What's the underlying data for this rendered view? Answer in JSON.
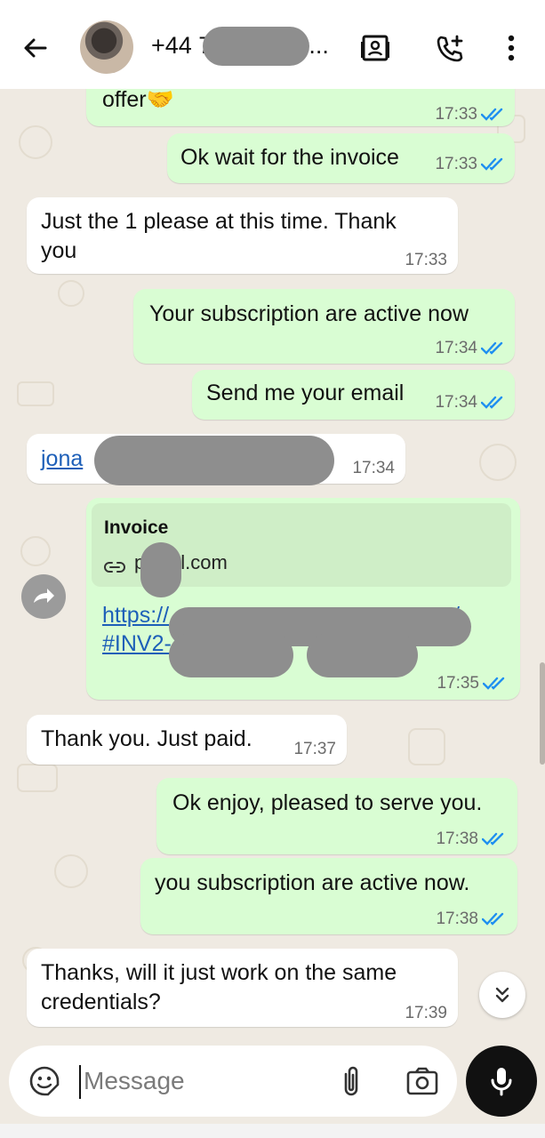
{
  "header": {
    "back_icon": "arrow-left-icon",
    "title": "+44 7",
    "title_suffix": "3...",
    "contact_icon": "contact-card-icon",
    "call_icon": "add-call-icon",
    "menu_icon": "more-vert-icon"
  },
  "messages": [
    {
      "dir": "out",
      "text": "offer🤝",
      "time": "17:33",
      "ticks": true
    },
    {
      "dir": "out",
      "text": "Ok wait for the invoice",
      "time": "17:33",
      "ticks": true
    },
    {
      "dir": "in",
      "line1": "Just the 1 please at this time. Thank",
      "line2": "you",
      "time": "17:33"
    },
    {
      "dir": "out",
      "text": "Your subscription are active now",
      "time": "17:34",
      "ticks": true
    },
    {
      "dir": "out",
      "text": "Send me your email",
      "time": "17:34",
      "ticks": true
    },
    {
      "dir": "in",
      "link": "jona",
      "time": "17:34"
    },
    {
      "dir": "out",
      "preview_title": "Invoice",
      "preview_domain_start": "p",
      "preview_domain_end": "l.com",
      "url_line1": "https://",
      "url_line1_end": "/",
      "url_line2": "#INV2-",
      "time": "17:35",
      "ticks": true
    },
    {
      "dir": "in",
      "text": "Thank you. Just paid.",
      "time": "17:37"
    },
    {
      "dir": "out",
      "text": "Ok enjoy, pleased to serve you.",
      "time": "17:38",
      "ticks": true
    },
    {
      "dir": "out",
      "text": "you subscription are active now.",
      "time": "17:38",
      "ticks": true
    },
    {
      "dir": "in",
      "line1": "Thanks, will it just work on the same",
      "line2": "credentials?",
      "time": "17:39"
    }
  ],
  "composer": {
    "placeholder": "Message",
    "emoji_icon": "emoji-sticker-icon",
    "attach_icon": "paperclip-icon",
    "camera_icon": "camera-icon",
    "mic_icon": "microphone-icon"
  },
  "colors": {
    "outgoing_bubble": "#d9fdd3",
    "incoming_bubble": "#ffffff",
    "read_ticks": "#1f8ff0",
    "chat_background": "#efeae2",
    "link": "#1d5fb8"
  }
}
